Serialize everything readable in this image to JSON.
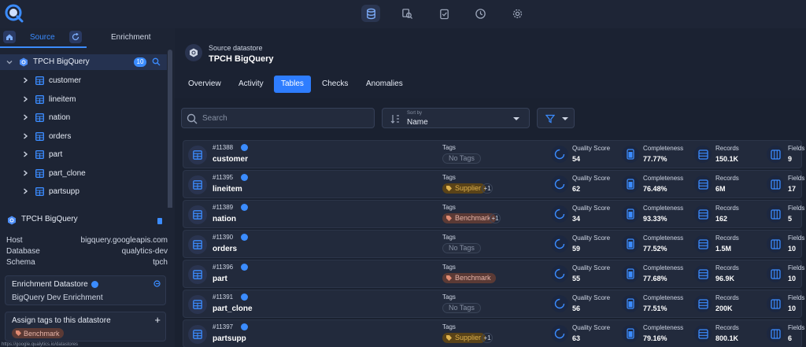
{
  "topnav": {
    "icons": [
      "database-icon",
      "search-db-icon",
      "clipboard-check-icon",
      "clock-icon",
      "gear-icon"
    ]
  },
  "left": {
    "tabs": {
      "source": "Source",
      "enrichment": "Enrichment"
    },
    "datastore": {
      "name": "TPCH BigQuery",
      "count": "10"
    },
    "tables": [
      "customer",
      "lineitem",
      "nation",
      "orders",
      "part",
      "part_clone",
      "partsupp"
    ],
    "details": {
      "title": "TPCH BigQuery",
      "host_label": "Host",
      "host_value": "bigquery.googleapis.com",
      "database_label": "Database",
      "database_value": "qualytics-dev",
      "schema_label": "Schema",
      "schema_value": "tpch",
      "enrichment_title": "Enrichment Datastore",
      "enrichment_value": "BigQuery Dev Enrichment",
      "assign_title": "Assign tags to this datastore",
      "assign_tag": "Benchmark"
    },
    "footer_url": "https://google.qualytics.io/datastores"
  },
  "header": {
    "subtitle": "Source datastore",
    "title": "TPCH BigQuery"
  },
  "tabs": [
    "Overview",
    "Activity",
    "Tables",
    "Checks",
    "Anomalies"
  ],
  "controls": {
    "search_placeholder": "Search",
    "sort_label": "Sort by",
    "sort_value": "Name"
  },
  "labels": {
    "tags": "Tags",
    "quality": "Quality Score",
    "completeness": "Completeness",
    "records": "Records",
    "fields": "Fields",
    "no_tags": "No Tags"
  },
  "rows": [
    {
      "id": "#11388",
      "name": "customer",
      "tag": "No Tags",
      "tag_type": "none",
      "extra": "",
      "quality": "54",
      "completeness": "77.77%",
      "records": "150.1K",
      "fields": "9"
    },
    {
      "id": "#11395",
      "name": "lineitem",
      "tag": "Supplier",
      "tag_type": "supplier",
      "extra": "+1",
      "quality": "62",
      "completeness": "76.48%",
      "records": "6M",
      "fields": "17"
    },
    {
      "id": "#11389",
      "name": "nation",
      "tag": "Benchmark",
      "tag_type": "bench",
      "extra": "+1",
      "quality": "34",
      "completeness": "93.33%",
      "records": "162",
      "fields": "5"
    },
    {
      "id": "#11390",
      "name": "orders",
      "tag": "No Tags",
      "tag_type": "none",
      "extra": "",
      "quality": "59",
      "completeness": "77.52%",
      "records": "1.5M",
      "fields": "10"
    },
    {
      "id": "#11396",
      "name": "part",
      "tag": "Benchmark",
      "tag_type": "bench",
      "extra": "",
      "quality": "55",
      "completeness": "77.68%",
      "records": "96.9K",
      "fields": "10"
    },
    {
      "id": "#11391",
      "name": "part_clone",
      "tag": "No Tags",
      "tag_type": "none",
      "extra": "",
      "quality": "56",
      "completeness": "77.51%",
      "records": "200K",
      "fields": "10"
    },
    {
      "id": "#11397",
      "name": "partsupp",
      "tag": "Supplier",
      "tag_type": "supplier",
      "extra": "+1",
      "quality": "63",
      "completeness": "79.16%",
      "records": "800.1K",
      "fields": "6"
    }
  ],
  "colors": {
    "accent": "#2e7dff",
    "bg": "#1b2232",
    "supplier": "#e0b34e",
    "benchmark": "#e6b4a8"
  }
}
